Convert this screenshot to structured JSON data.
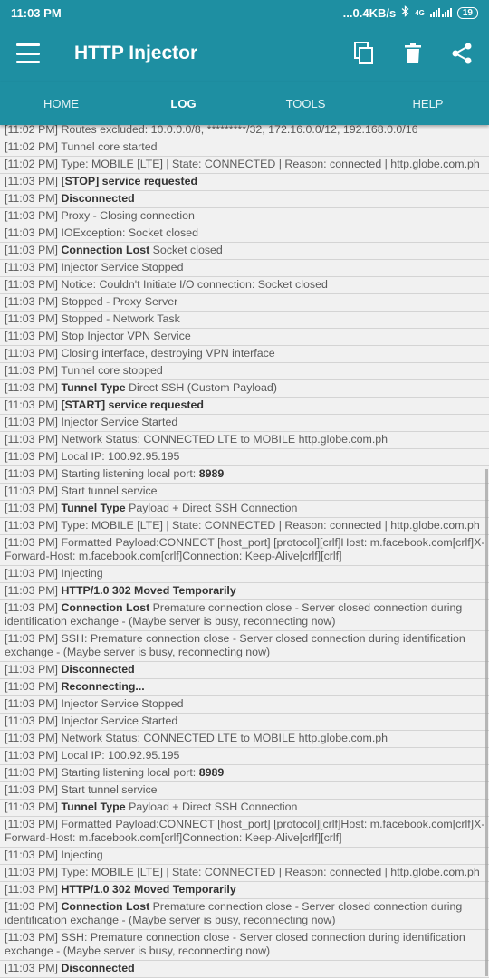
{
  "status_bar": {
    "time": "11:03 PM",
    "speed": "...0.4KB/s",
    "network": "4G",
    "battery": "19"
  },
  "app_bar": {
    "title": "HTTP Injector"
  },
  "tabs": [
    "HOME",
    "LOG",
    "TOOLS",
    "HELP"
  ],
  "log": [
    {
      "ts": "[11:02 PM]",
      "bold": "",
      "text": "Routes excluded: 10.0.0.0/8, *********/32, 172.16.0.0/12, 192.168.0.0/16"
    },
    {
      "ts": "[11:02 PM]",
      "bold": "",
      "text": "Tunnel core started"
    },
    {
      "ts": "[11:02 PM]",
      "bold": "",
      "text": "Type: MOBILE [LTE] | State: CONNECTED | Reason: connected | http.globe.com.ph"
    },
    {
      "ts": "[11:03 PM]",
      "bold": "[STOP] service requested",
      "text": ""
    },
    {
      "ts": "[11:03 PM]",
      "bold": "Disconnected",
      "text": ""
    },
    {
      "ts": "[11:03 PM]",
      "bold": "",
      "text": "Proxy - Closing connection"
    },
    {
      "ts": "[11:03 PM]",
      "bold": "",
      "text": "IOException: Socket closed"
    },
    {
      "ts": "[11:03 PM]",
      "bold": "Connection Lost",
      "text": "Socket closed"
    },
    {
      "ts": "[11:03 PM]",
      "bold": "",
      "text": "Injector Service Stopped"
    },
    {
      "ts": "[11:03 PM]",
      "bold": "",
      "text": "Notice: Couldn't Initiate I/O connection: Socket closed"
    },
    {
      "ts": "[11:03 PM]",
      "bold": "",
      "text": "Stopped - Proxy Server"
    },
    {
      "ts": "[11:03 PM]",
      "bold": "",
      "text": "Stopped - Network Task"
    },
    {
      "ts": "[11:03 PM]",
      "bold": "",
      "text": "Stop Injector VPN Service"
    },
    {
      "ts": "[11:03 PM]",
      "bold": "",
      "text": "Closing interface, destroying VPN interface"
    },
    {
      "ts": "[11:03 PM]",
      "bold": "",
      "text": "Tunnel core stopped"
    },
    {
      "ts": "[11:03 PM]",
      "bold": "Tunnel Type",
      "text": "Direct SSH (Custom Payload)"
    },
    {
      "ts": "[11:03 PM]",
      "bold": "[START] service requested",
      "text": ""
    },
    {
      "ts": "[11:03 PM]",
      "bold": "",
      "text": "Injector Service Started"
    },
    {
      "ts": "[11:03 PM]",
      "bold": "",
      "text": "Network Status: CONNECTED LTE to MOBILE http.globe.com.ph"
    },
    {
      "ts": "[11:03 PM]",
      "bold": "",
      "text": "Local IP: 100.92.95.195"
    },
    {
      "ts": "[11:03 PM]",
      "bold": "",
      "text": "Starting listening local port:",
      "bold_after": "8989"
    },
    {
      "ts": "[11:03 PM]",
      "bold": "",
      "text": "Start tunnel service"
    },
    {
      "ts": "[11:03 PM]",
      "bold": "Tunnel Type",
      "text": "Payload + Direct SSH Connection"
    },
    {
      "ts": "[11:03 PM]",
      "bold": "",
      "text": "Type: MOBILE [LTE] | State: CONNECTED | Reason: connected | http.globe.com.ph"
    },
    {
      "ts": "[11:03 PM]",
      "bold": "",
      "text": "Formatted Payload:CONNECT [host_port] [protocol][crlf]Host: m.facebook.com[crlf]X-Forward-Host: m.facebook.com[crlf]Connection: Keep-Alive[crlf][crlf]",
      "wrap": true
    },
    {
      "ts": "[11:03 PM]",
      "bold": "",
      "text": "Injecting"
    },
    {
      "ts": "[11:03 PM]",
      "bold": "HTTP/1.0 302 Moved Temporarily",
      "text": ""
    },
    {
      "ts": "[11:03 PM]",
      "bold": "Connection Lost",
      "text": "Premature connection close - Server closed connection during identification exchange - (Maybe server is busy, reconnecting now)",
      "wrap": true
    },
    {
      "ts": "[11:03 PM]",
      "bold": "",
      "text": "SSH: Premature connection close - Server closed connection during identification exchange - (Maybe server is busy, reconnecting now)",
      "wrap": true
    },
    {
      "ts": "[11:03 PM]",
      "bold": "Disconnected",
      "text": ""
    },
    {
      "ts": "[11:03 PM]",
      "bold": "Reconnecting...",
      "text": ""
    },
    {
      "ts": "[11:03 PM]",
      "bold": "",
      "text": "Injector Service Stopped"
    },
    {
      "ts": "[11:03 PM]",
      "bold": "",
      "text": "Injector Service Started"
    },
    {
      "ts": "[11:03 PM]",
      "bold": "",
      "text": "Network Status: CONNECTED LTE to MOBILE http.globe.com.ph"
    },
    {
      "ts": "[11:03 PM]",
      "bold": "",
      "text": "Local IP: 100.92.95.195"
    },
    {
      "ts": "[11:03 PM]",
      "bold": "",
      "text": "Starting listening local port:",
      "bold_after": "8989"
    },
    {
      "ts": "[11:03 PM]",
      "bold": "",
      "text": "Start tunnel service"
    },
    {
      "ts": "[11:03 PM]",
      "bold": "Tunnel Type",
      "text": "Payload + Direct SSH Connection"
    },
    {
      "ts": "[11:03 PM]",
      "bold": "",
      "text": "Formatted Payload:CONNECT [host_port] [protocol][crlf]Host: m.facebook.com[crlf]X-Forward-Host: m.facebook.com[crlf]Connection: Keep-Alive[crlf][crlf]",
      "wrap": true
    },
    {
      "ts": "[11:03 PM]",
      "bold": "",
      "text": "Injecting"
    },
    {
      "ts": "[11:03 PM]",
      "bold": "",
      "text": "Type: MOBILE [LTE] | State: CONNECTED | Reason: connected | http.globe.com.ph"
    },
    {
      "ts": "[11:03 PM]",
      "bold": "HTTP/1.0 302 Moved Temporarily",
      "text": ""
    },
    {
      "ts": "[11:03 PM]",
      "bold": "Connection Lost",
      "text": "Premature connection close - Server closed connection during identification exchange - (Maybe server is busy, reconnecting now)",
      "wrap": true
    },
    {
      "ts": "[11:03 PM]",
      "bold": "",
      "text": "SSH: Premature connection close - Server closed connection during identification exchange - (Maybe server is busy, reconnecting now)",
      "wrap": true
    },
    {
      "ts": "[11:03 PM]",
      "bold": "Disconnected",
      "text": ""
    }
  ]
}
